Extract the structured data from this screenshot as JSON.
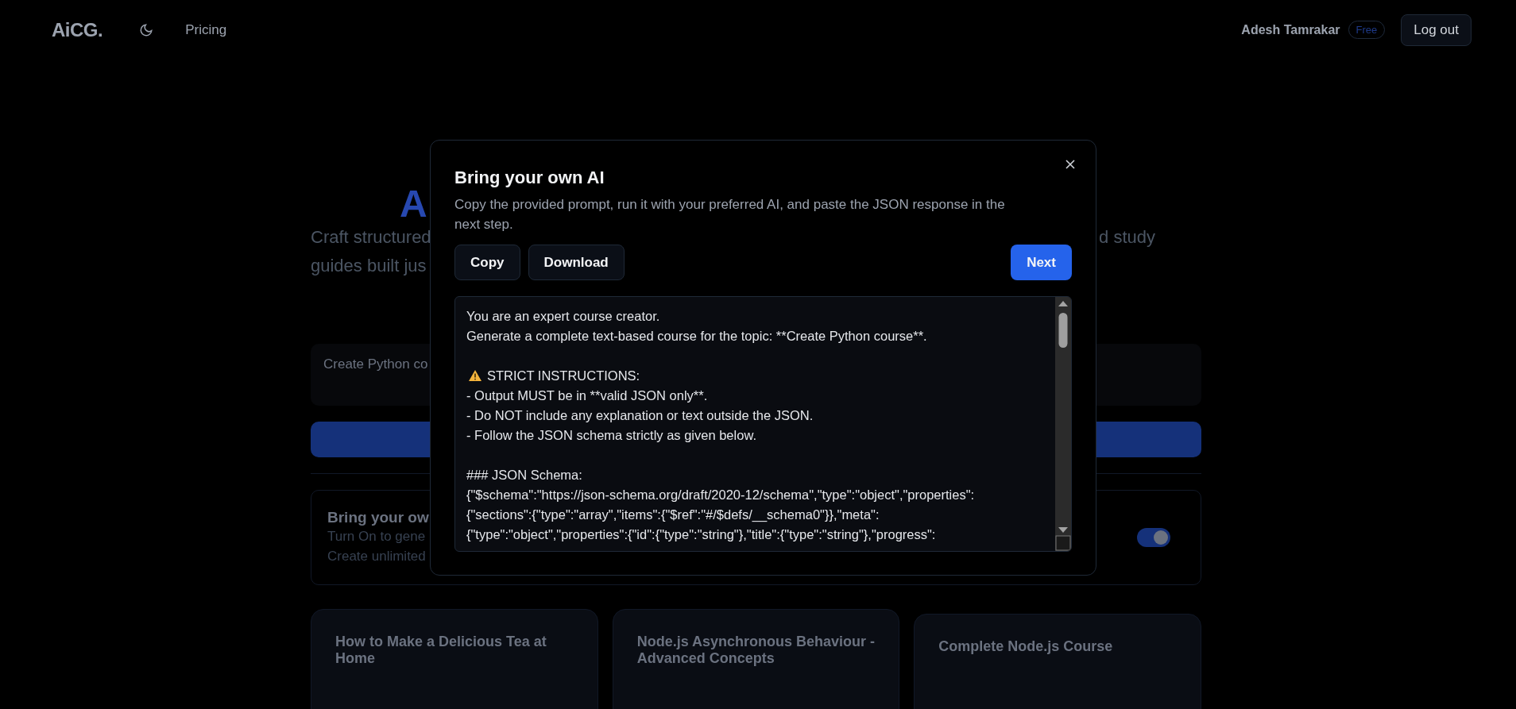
{
  "header": {
    "logo": "AiCG.",
    "nav": [
      {
        "label": "Pricing"
      }
    ],
    "user": "Adesh Tamrakar",
    "plan_badge": "Free",
    "logout": "Log out"
  },
  "hero": {
    "heading_fragment": "A",
    "subtitle_lines": [
      {
        "left": "Craft structured",
        "right": "d study"
      },
      {
        "left": "guides built jus"
      }
    ]
  },
  "prompt_input": {
    "value": "Create Python co"
  },
  "byo_card": {
    "title": "Bring your ow",
    "lines": [
      "Turn On to gene",
      "Create unlimited"
    ],
    "on": true
  },
  "courses": [
    {
      "title": "How to Make a Delicious Tea at Home"
    },
    {
      "title": "Node.js Asynchronous Behaviour - Advanced Concepts"
    },
    {
      "title": "Complete Node.js Course"
    }
  ],
  "modal": {
    "title": "Bring your own AI",
    "description": "Copy the provided prompt, run it with your preferred AI, and paste the JSON response in the next step.",
    "buttons": [
      {
        "label": "Copy",
        "kind": "secondary"
      },
      {
        "label": "Download",
        "kind": "secondary"
      },
      {
        "label": "Next",
        "kind": "primary"
      }
    ],
    "prompt_lines": [
      {
        "kind": "text",
        "text": "You are an expert course creator."
      },
      {
        "kind": "text",
        "text": "Generate a complete text-based course for the topic: **Create Python course**."
      },
      {
        "kind": "blank"
      },
      {
        "kind": "warning",
        "text": "STRICT INSTRUCTIONS:"
      },
      {
        "kind": "text",
        "text": "- Output MUST be in **valid JSON only**."
      },
      {
        "kind": "text",
        "text": "- Do NOT include any explanation or text outside the JSON."
      },
      {
        "kind": "text",
        "text": "- Follow the JSON schema strictly as given below."
      },
      {
        "kind": "blank"
      },
      {
        "kind": "text",
        "text": "### JSON Schema:"
      },
      {
        "kind": "text",
        "text": "{\"$schema\":\"https://json-schema.org/draft/2020-12/schema\",\"type\":\"object\",\"properties\":"
      },
      {
        "kind": "text",
        "text": "{\"sections\":{\"type\":\"array\",\"items\":{\"$ref\":\"#/$defs/__schema0\"}},\"meta\":"
      },
      {
        "kind": "text",
        "text": "{\"type\":\"object\",\"properties\":{\"id\":{\"type\":\"string\"},\"title\":{\"type\":\"string\"},\"progress\":"
      }
    ]
  }
}
